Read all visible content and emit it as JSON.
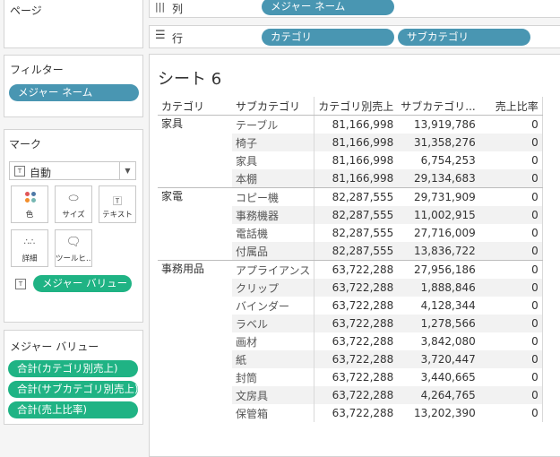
{
  "pages": {
    "title": "ページ"
  },
  "columns_shelf": {
    "label": "列",
    "pill": "メジャー ネーム"
  },
  "rows_shelf": {
    "label": "行",
    "pills": [
      "カテゴリ",
      "サブカテゴリ"
    ]
  },
  "filters": {
    "title": "フィルター",
    "pill": "メジャー ネーム"
  },
  "marks": {
    "title": "マーク",
    "mark_type": "自動",
    "buttons": [
      {
        "icon": "color-icon",
        "label": "色"
      },
      {
        "icon": "size-icon",
        "label": "サイズ"
      },
      {
        "icon": "text-icon",
        "label": "テキスト"
      },
      {
        "icon": "detail-icon",
        "label": "詳細"
      },
      {
        "icon": "tooltip-icon",
        "label": "ツールヒ..."
      }
    ],
    "text_pill": "メジャー バリュー"
  },
  "measure_values": {
    "title": "メジャー バリュー",
    "pills": [
      "合計(カテゴリ別売上)",
      "合計(サブカテゴリ別売上)",
      "合計(売上比率)"
    ]
  },
  "sheet": {
    "title": "シート 6"
  },
  "table": {
    "headers": [
      "カテゴリ",
      "サブカテゴリ",
      "カテゴリ別売上",
      "サブカテゴリ...",
      "売上比率"
    ],
    "groups": [
      {
        "category": "家具",
        "rows": [
          [
            "テーブル",
            "81,166,998",
            "13,919,786",
            "0"
          ],
          [
            "椅子",
            "81,166,998",
            "31,358,276",
            "0"
          ],
          [
            "家具",
            "81,166,998",
            "6,754,253",
            "0"
          ],
          [
            "本棚",
            "81,166,998",
            "29,134,683",
            "0"
          ]
        ]
      },
      {
        "category": "家電",
        "rows": [
          [
            "コピー機",
            "82,287,555",
            "29,731,909",
            "0"
          ],
          [
            "事務機器",
            "82,287,555",
            "11,002,915",
            "0"
          ],
          [
            "電話機",
            "82,287,555",
            "27,716,009",
            "0"
          ],
          [
            "付属品",
            "82,287,555",
            "13,836,722",
            "0"
          ]
        ]
      },
      {
        "category": "事務用品",
        "rows": [
          [
            "アプライアンス",
            "63,722,288",
            "27,956,186",
            "0"
          ],
          [
            "クリップ",
            "63,722,288",
            "1,888,846",
            "0"
          ],
          [
            "バインダー",
            "63,722,288",
            "4,128,344",
            "0"
          ],
          [
            "ラベル",
            "63,722,288",
            "1,278,566",
            "0"
          ],
          [
            "画材",
            "63,722,288",
            "3,842,080",
            "0"
          ],
          [
            "紙",
            "63,722,288",
            "3,720,447",
            "0"
          ],
          [
            "封筒",
            "63,722,288",
            "3,440,665",
            "0"
          ],
          [
            "文房具",
            "63,722,288",
            "4,264,765",
            "0"
          ],
          [
            "保管箱",
            "63,722,288",
            "13,202,390",
            "0"
          ]
        ]
      }
    ]
  },
  "colors": {
    "dimension_pill": "#4996b2",
    "measure_pill": "#1fb384"
  }
}
